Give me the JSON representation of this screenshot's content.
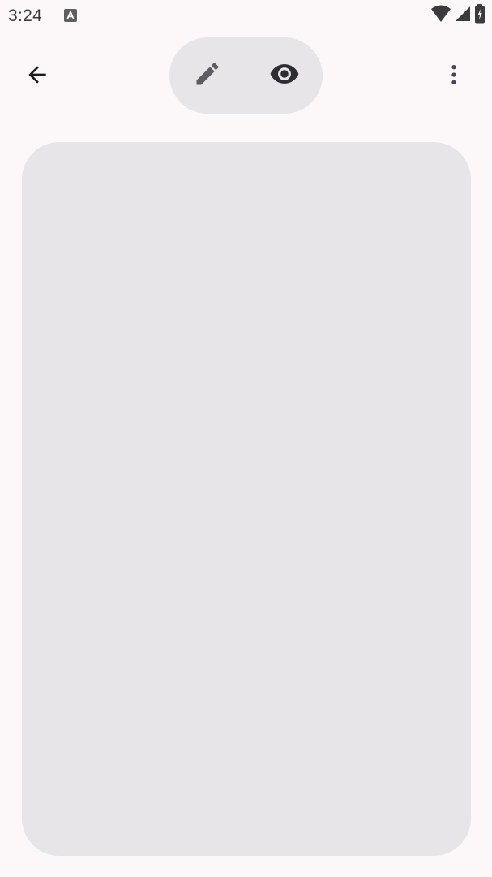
{
  "status_bar": {
    "time": "3:24",
    "notification_icon": "a-letter-icon",
    "icons": [
      "wifi-icon",
      "signal-icon",
      "battery-charging-icon"
    ]
  },
  "toolbar": {
    "back_icon": "arrow-back-icon",
    "mode_toggle": {
      "edit_icon": "pencil-icon",
      "preview_icon": "eye-icon"
    },
    "overflow_icon": "more-vert-icon"
  },
  "colors": {
    "background": "#fcf8f9",
    "surface": "#e7e5e7",
    "icon": "#1c1b1f",
    "icon_muted": "#49454f"
  }
}
